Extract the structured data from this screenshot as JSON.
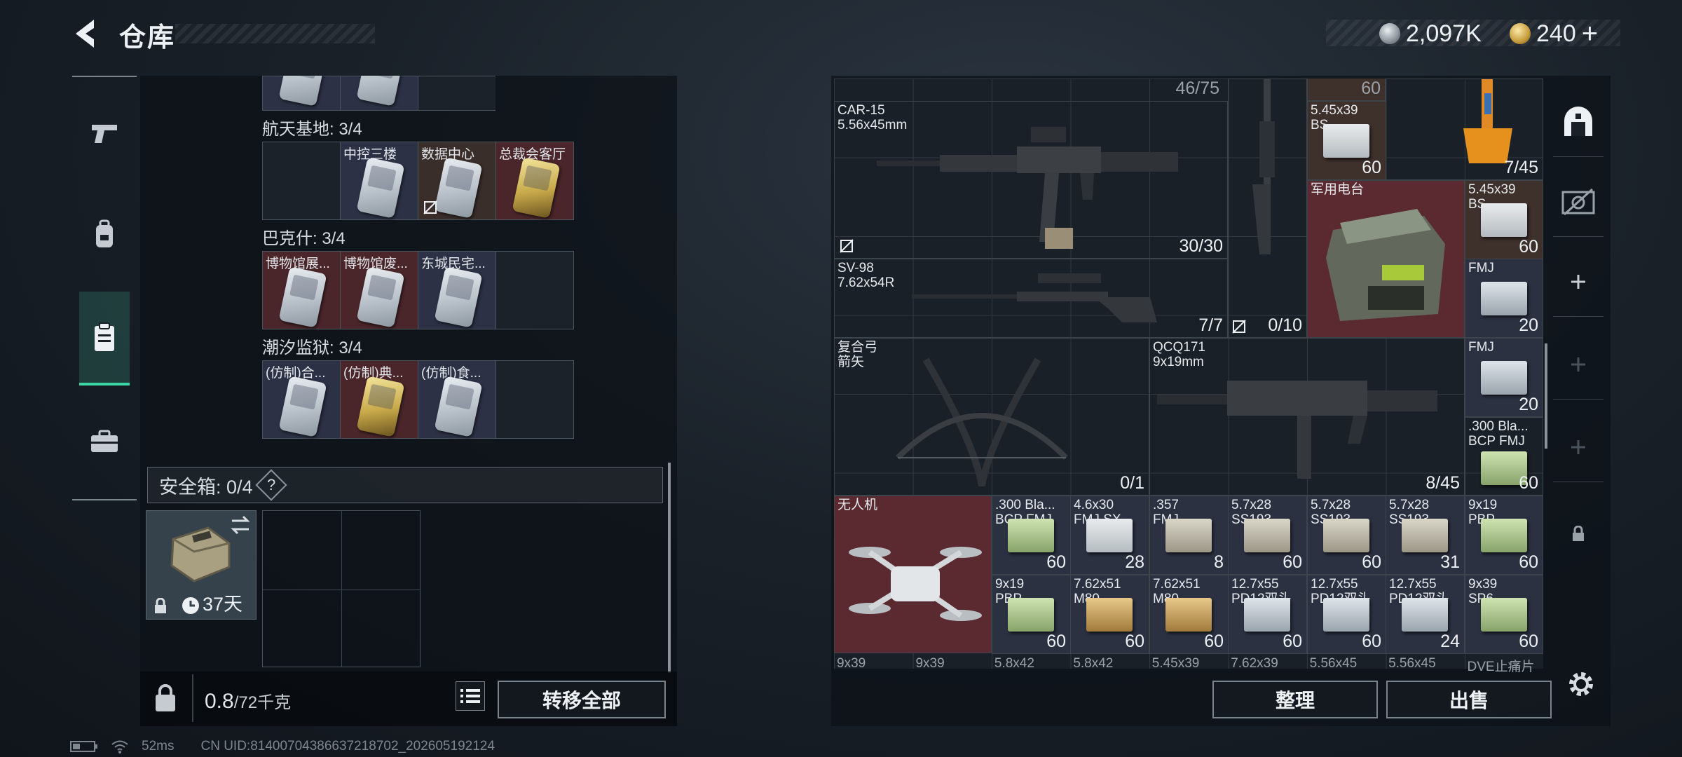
{
  "header": {
    "title": "仓库",
    "currency_1": "2,097K",
    "currency_2": "240",
    "add_symbol": "+"
  },
  "colors": {
    "accent": "#39d5a5",
    "rarity_red": "#5a2a30",
    "rarity_purple": "#2c3142",
    "rarity_gold": "#3e302b"
  },
  "left_tabs": [
    {
      "icon": "pistol-icon"
    },
    {
      "icon": "backpack-icon"
    },
    {
      "icon": "clipboard-icon",
      "active": true
    },
    {
      "icon": "briefcase-icon"
    }
  ],
  "key_sections": [
    {
      "title": "航天基地: 3/4",
      "cells": [
        "",
        "中控三楼",
        "数据中心",
        "总裁会客厅"
      ]
    },
    {
      "title": "巴克什: 3/4",
      "cells": [
        "博物馆展...",
        "博物馆废...",
        "东城民宅...",
        ""
      ]
    },
    {
      "title": "潮汐监狱: 3/4",
      "cells": [
        "(仿制)合...",
        "(仿制)典...",
        "(仿制)食...",
        ""
      ]
    }
  ],
  "safe_box": {
    "title": "安全箱: 0/4",
    "help": "?",
    "duration": "37天"
  },
  "bottom_left": {
    "weight_value": "0.8",
    "weight_max": "/72千克",
    "transfer_all": "转移全部"
  },
  "stash_header": {
    "capacity": "46/75",
    "top_qty_1": "60"
  },
  "stash_items": {
    "car15": {
      "name": "CAR-15\n5.56x45mm",
      "qty": "30/30"
    },
    "sv98": {
      "name": "SV-98\n7.62x54R",
      "qty": "7/7"
    },
    "rifle_mid": {
      "qty": "0/10"
    },
    "ammo_545_bs": {
      "name": "5.45x39\nBS",
      "qty": "60"
    },
    "orange_item": {
      "qty": "7/45"
    },
    "radio": {
      "name": "军用电台"
    },
    "ammo_545_bs2": {
      "name": "5.45x39\nBS",
      "qty": "60"
    },
    "fmj_1": {
      "name": "FMJ",
      "qty": "20"
    },
    "bow": {
      "name": "复合弓\n箭矢",
      "qty": "0/1"
    },
    "qcq": {
      "name": "QCQ171\n9x19mm",
      "qty": "8/45"
    },
    "fmj_2": {
      "name": "FMJ",
      "qty": "20"
    },
    "ammo_300_bcp": {
      "name": ".300 Bla...\nBCP FMJ",
      "qty": "60"
    },
    "drone": {
      "name": "无人机"
    },
    "r1": [
      {
        "name": ".300 Bla...\nBCP FMJ",
        "qty": "60"
      },
      {
        "name": "4.6x30\nFMJ SX",
        "qty": "28"
      },
      {
        "name": ".357\nFMJ",
        "qty": "8"
      },
      {
        "name": "5.7x28\nSS193",
        "qty": "60"
      },
      {
        "name": "5.7x28\nSS193",
        "qty": "60"
      },
      {
        "name": "5.7x28\nSS193",
        "qty": "31"
      },
      {
        "name": "9x19\nPBP",
        "qty": "60"
      }
    ],
    "r2": [
      {
        "name": "9x19\nPBP",
        "qty": "60"
      },
      {
        "name": "7.62x51\nM80",
        "qty": "60"
      },
      {
        "name": "7.62x51\nM80",
        "qty": "60"
      },
      {
        "name": "12.7x55\nPD12双头",
        "qty": "60"
      },
      {
        "name": "12.7x55\nPD12双头",
        "qty": "60"
      },
      {
        "name": "12.7x55\nPD12双头",
        "qty": "24"
      },
      {
        "name": "9x39\nSP6",
        "qty": "60"
      }
    ],
    "partial_row": [
      "9x39",
      "9x39",
      "5.8x42",
      "5.8x42",
      "5.45x39",
      "7.62x39",
      "5.56x45",
      "5.56x45",
      "DVE止痛片"
    ]
  },
  "bottom_right": {
    "sort": "整理",
    "sell": "出售"
  },
  "status": {
    "ping": "52ms",
    "uid": "CN UID:8140070438663721870​2_202605192124"
  }
}
